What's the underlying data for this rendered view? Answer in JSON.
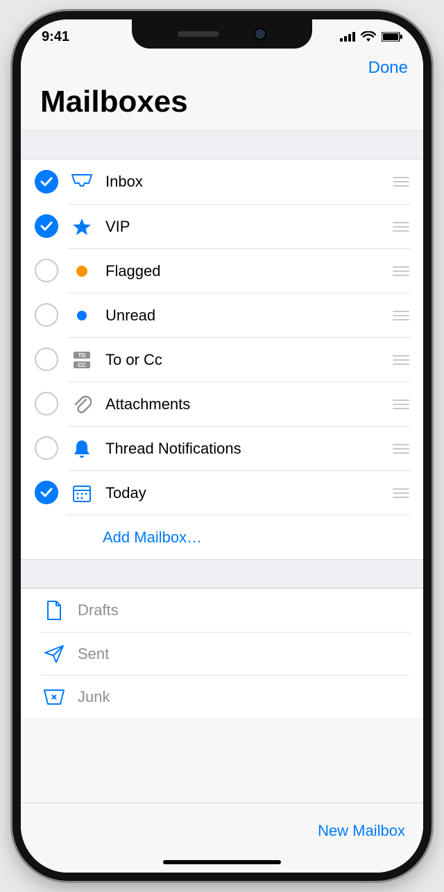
{
  "statusbar": {
    "time": "9:41"
  },
  "nav": {
    "done": "Done"
  },
  "page": {
    "title": "Mailboxes"
  },
  "mailboxes": {
    "items": [
      {
        "label": "Inbox",
        "checked": true,
        "icon": "inbox"
      },
      {
        "label": "VIP",
        "checked": true,
        "icon": "star"
      },
      {
        "label": "Flagged",
        "checked": false,
        "icon": "flag"
      },
      {
        "label": "Unread",
        "checked": false,
        "icon": "unread"
      },
      {
        "label": "To or Cc",
        "checked": false,
        "icon": "tocc"
      },
      {
        "label": "Attachments",
        "checked": false,
        "icon": "clip"
      },
      {
        "label": "Thread Notifications",
        "checked": false,
        "icon": "bell"
      },
      {
        "label": "Today",
        "checked": true,
        "icon": "calendar"
      }
    ],
    "add": "Add Mailbox…"
  },
  "folders": {
    "items": [
      {
        "label": "Drafts",
        "icon": "doc"
      },
      {
        "label": "Sent",
        "icon": "plane"
      },
      {
        "label": "Junk",
        "icon": "junk"
      }
    ]
  },
  "toolbar": {
    "newMailbox": "New Mailbox"
  },
  "colors": {
    "accent": "#007aff",
    "flag": "#ff9500"
  }
}
